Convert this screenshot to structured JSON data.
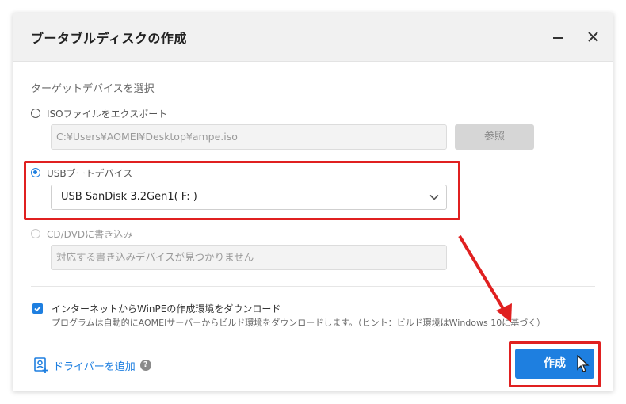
{
  "dialog": {
    "title": "ブータブルディスクの作成",
    "minimize_icon": "minimize-icon",
    "close_icon": "close-icon"
  },
  "target_section": {
    "label": "ターゲットデバイスを選択"
  },
  "options": {
    "iso": {
      "label": "ISOファイルをエクスポート",
      "path_value": "C:¥Users¥AOMEI¥Desktop¥ampe.iso",
      "browse_label": "参照",
      "selected": false
    },
    "usb": {
      "label": "USBブートデバイス",
      "device_value": "USB SanDisk 3.2Gen1( F: )",
      "selected": true
    },
    "cd": {
      "label": "CD/DVDに書き込み",
      "placeholder": "対応する書き込みデバイスが見つかりません",
      "selected": false,
      "disabled": true
    }
  },
  "download": {
    "checked": true,
    "title": "インターネットからWinPEの作成環境をダウンロード",
    "description": "プログラムは自動的にAOMEIサーバーからビルド環境をダウンロードします。（ヒント：ビルド環境はWindows 10に基づく）"
  },
  "footer": {
    "driver_label": "ドライバーを追加",
    "help_glyph": "?",
    "create_label": "作成"
  },
  "colors": {
    "accent": "#1e7fe0",
    "highlight": "#e02020"
  }
}
